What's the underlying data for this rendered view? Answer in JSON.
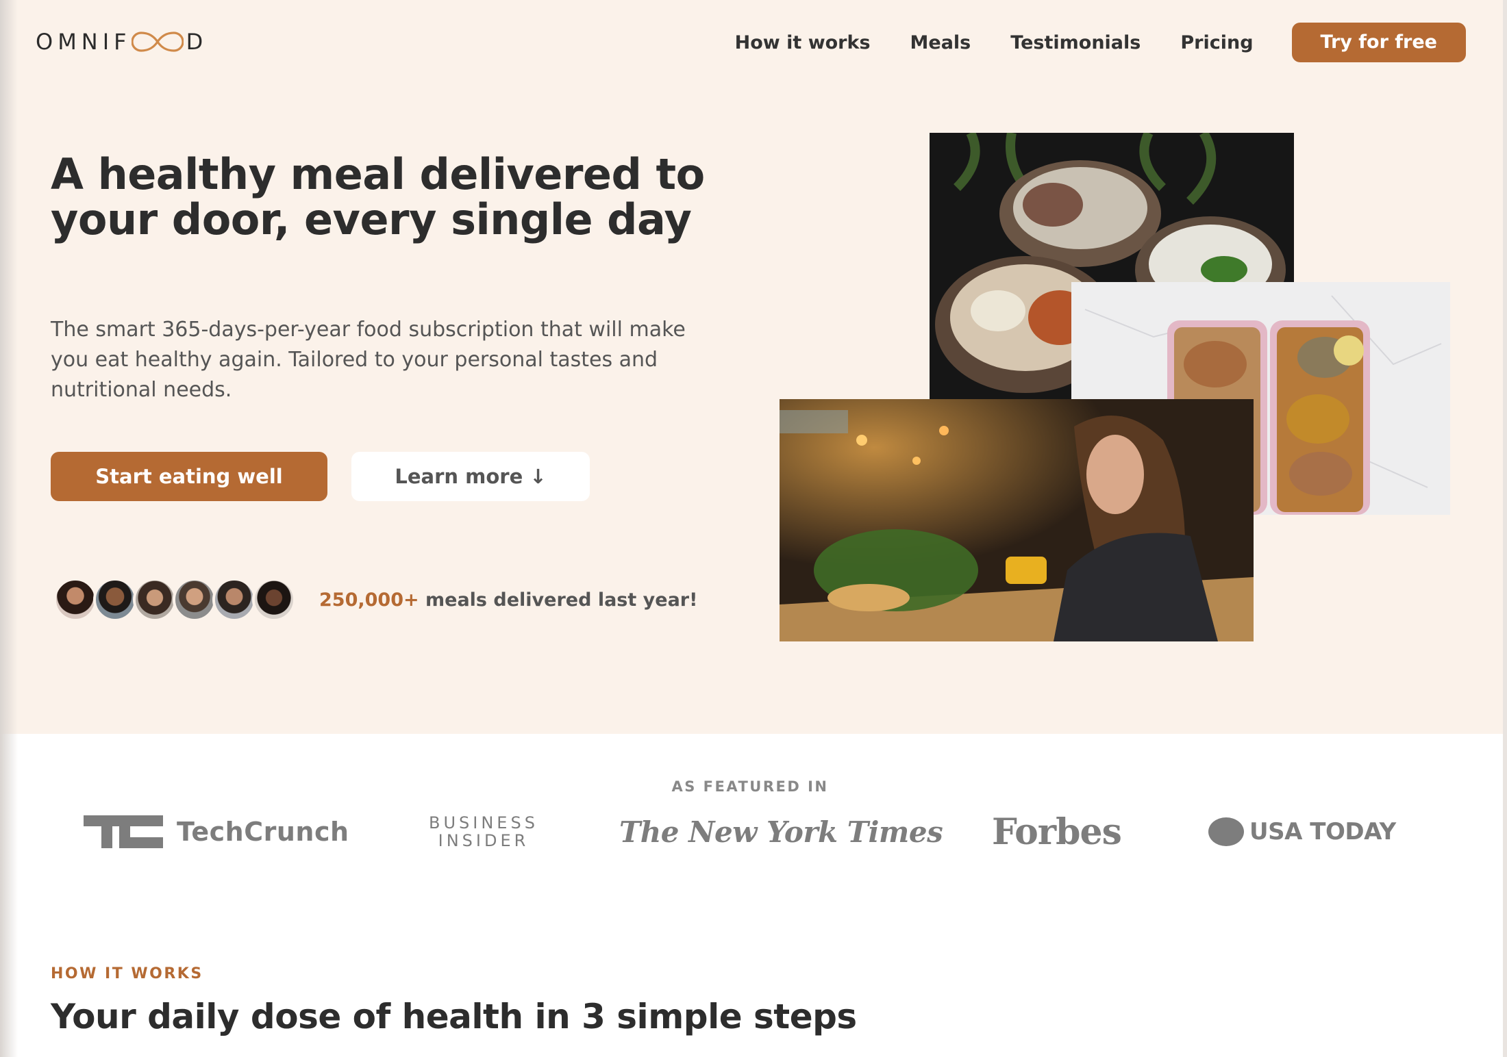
{
  "header": {
    "logo_text_left": "OMNIF",
    "logo_text_right": "D",
    "nav": [
      {
        "label": "How it works"
      },
      {
        "label": "Meals"
      },
      {
        "label": "Testimonials"
      },
      {
        "label": "Pricing"
      }
    ],
    "cta_label": "Try for free"
  },
  "hero": {
    "headline": "A healthy meal delivered to your door, every single day",
    "description": "The smart 365-days-per-year food subscription that will make you eat healthy again. Tailored to your personal tastes and nutritional needs.",
    "primary_button": "Start eating well",
    "secondary_button": "Learn more ↓",
    "stat_number": "250,000+",
    "stat_text": " meals delivered last year!"
  },
  "featured": {
    "label": "AS FEATURED IN",
    "logos": {
      "techcrunch": "TechCrunch",
      "business_insider_1": "BUSINESS",
      "business_insider_2": "INSIDER",
      "nyt": "The New York Times",
      "forbes": "Forbes",
      "usatoday": "USA TODAY"
    }
  },
  "how_it_works": {
    "subheading": "HOW IT WORKS",
    "title": "Your daily dose of health in 3 simple steps"
  },
  "colors": {
    "accent": "#b56a33",
    "hero_bg": "#fbf2ea",
    "text_dark": "#2d2d2d",
    "logo_gray": "#7d7d7d"
  },
  "icons": {
    "logo": "infinity-icon",
    "arrow": "arrow-down-icon"
  }
}
